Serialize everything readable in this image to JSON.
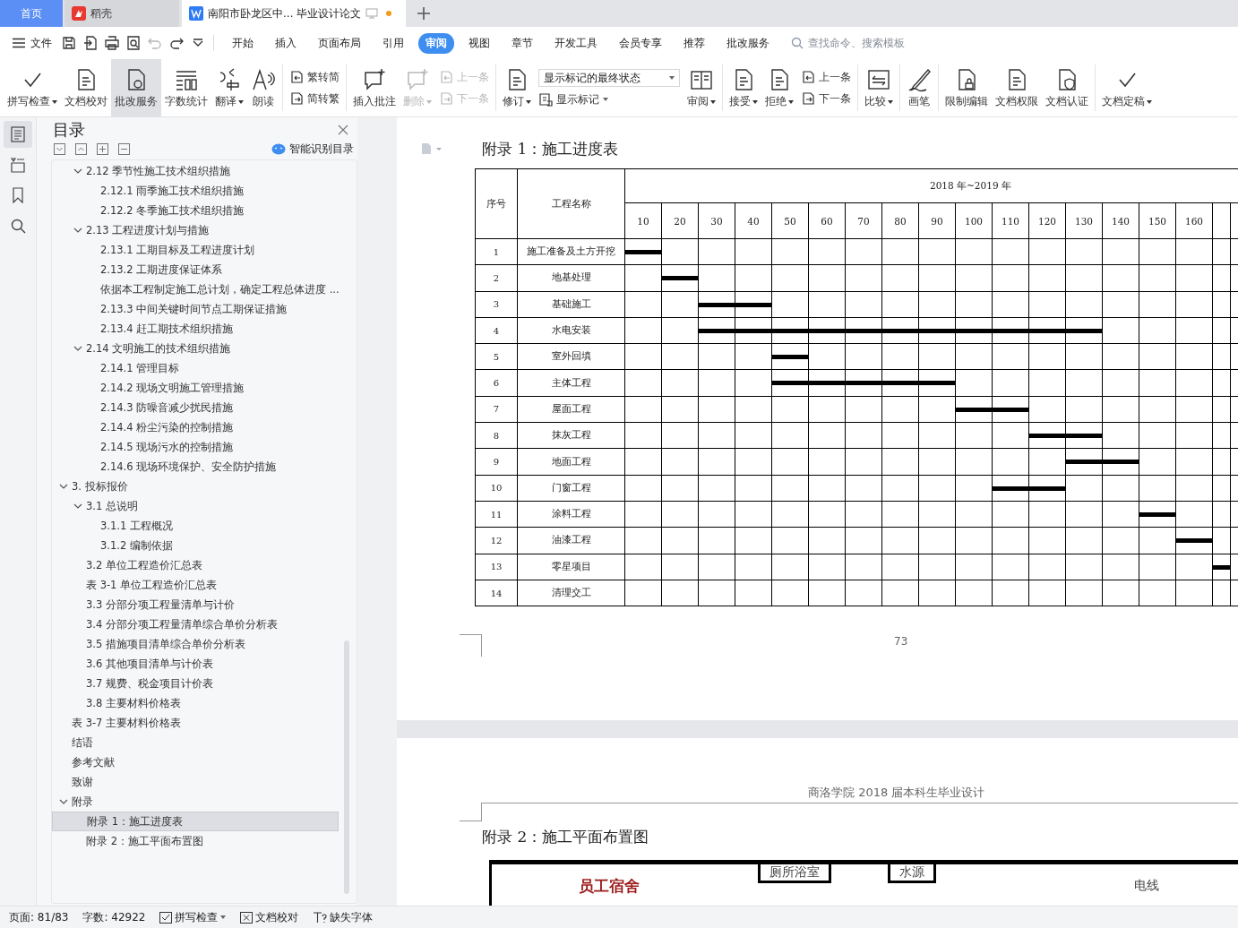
{
  "tabs": [
    {
      "label": "首页",
      "kind": "home",
      "selected": false
    },
    {
      "label": "稻壳",
      "kind": "docer",
      "selected": false
    },
    {
      "label": "南阳市卧龙区中... 毕业设计论文",
      "kind": "doc",
      "selected": true,
      "unsaved": true
    }
  ],
  "quick_access": [
    {
      "kind": "save",
      "disabled": false
    },
    {
      "kind": "export",
      "disabled": false
    },
    {
      "kind": "print",
      "disabled": false
    },
    {
      "kind": "preview",
      "disabled": false
    },
    {
      "kind": "undo",
      "disabled": true
    },
    {
      "kind": "redo",
      "disabled": false
    },
    {
      "kind": "more",
      "disabled": false
    }
  ],
  "file_menu": "文件",
  "menu_tabs": [
    {
      "label": "开始",
      "selected": false
    },
    {
      "label": "插入",
      "selected": false
    },
    {
      "label": "页面布局",
      "selected": false
    },
    {
      "label": "引用",
      "selected": false
    },
    {
      "label": "审阅",
      "selected": true
    },
    {
      "label": "视图",
      "selected": false
    },
    {
      "label": "章节",
      "selected": false
    },
    {
      "label": "开发工具",
      "selected": false
    },
    {
      "label": "会员专享",
      "selected": false
    },
    {
      "label": "推荐",
      "selected": false
    },
    {
      "label": "批改服务",
      "selected": false
    }
  ],
  "command_search": {
    "placeholder": "查找命令、搜索模板"
  },
  "ribbon": [
    [
      {
        "kind": "big",
        "label": "拼写检查",
        "dropdown": true,
        "selected": false,
        "disabled": false
      },
      {
        "kind": "big",
        "label": "文档校对",
        "dropdown": false,
        "selected": false,
        "disabled": false
      },
      {
        "kind": "big",
        "label": "批改服务",
        "dropdown": false,
        "selected": true,
        "disabled": false
      },
      {
        "kind": "big",
        "label": "字数统计",
        "dropdown": false,
        "selected": false,
        "disabled": false
      },
      {
        "kind": "big",
        "label": "翻译",
        "dropdown": true,
        "selected": false,
        "disabled": false
      },
      {
        "kind": "big",
        "label": "朗读",
        "dropdown": false,
        "selected": false,
        "disabled": false
      }
    ],
    [
      {
        "kind": "pair",
        "items": [
          {
            "label": "繁转简",
            "disabled": false
          },
          {
            "label": "简转繁",
            "disabled": false
          }
        ]
      }
    ],
    [
      {
        "kind": "big",
        "label": "插入批注",
        "dropdown": false,
        "selected": false,
        "disabled": false
      },
      {
        "kind": "big",
        "label": "删除",
        "dropdown": true,
        "selected": false,
        "disabled": true
      },
      {
        "kind": "pair",
        "items": [
          {
            "label": "上一条",
            "disabled": true
          },
          {
            "label": "下一条",
            "disabled": true
          }
        ]
      }
    ],
    [
      {
        "kind": "big",
        "label": "修订",
        "dropdown": true,
        "selected": false,
        "disabled": false
      },
      {
        "kind": "select",
        "value": "显示标记的最终状态",
        "below": "显示标记"
      },
      {
        "kind": "big",
        "label": "审阅",
        "dropdown": true,
        "selected": false,
        "disabled": false
      }
    ],
    [
      {
        "kind": "big",
        "label": "接受",
        "dropdown": true,
        "selected": false,
        "disabled": false
      },
      {
        "kind": "big",
        "label": "拒绝",
        "dropdown": true,
        "selected": false,
        "disabled": false
      },
      {
        "kind": "pair",
        "items": [
          {
            "label": "上一条",
            "disabled": false
          },
          {
            "label": "下一条",
            "disabled": false
          }
        ]
      }
    ],
    [
      {
        "kind": "big",
        "label": "比较",
        "dropdown": true,
        "selected": false,
        "disabled": false
      }
    ],
    [
      {
        "kind": "big",
        "label": "画笔",
        "dropdown": false,
        "selected": false,
        "disabled": false
      }
    ],
    [
      {
        "kind": "big",
        "label": "限制编辑",
        "dropdown": false,
        "selected": false,
        "disabled": false
      },
      {
        "kind": "big",
        "label": "文档权限",
        "dropdown": false,
        "selected": false,
        "disabled": false
      },
      {
        "kind": "big",
        "label": "文档认证",
        "dropdown": false,
        "selected": false,
        "disabled": false
      }
    ],
    [
      {
        "kind": "big",
        "label": "文档定稿",
        "dropdown": true,
        "selected": false,
        "disabled": false
      }
    ]
  ],
  "side_rail": [
    {
      "kind": "toc",
      "selected": true
    },
    {
      "kind": "outline",
      "selected": false
    },
    {
      "kind": "bookmark",
      "selected": false
    },
    {
      "kind": "search",
      "selected": false
    }
  ],
  "toc": {
    "title": "目录",
    "smart_button": "智能识别目录",
    "continued_items": [
      {
        "label": "2.12  季节性施工技术组织措施",
        "expanded": true,
        "selected": false,
        "children": [
          {
            "label": "2.12.1  雨季施工技术组织措施",
            "selected": false
          },
          {
            "label": "2.12.2  冬季施工技术组织措施",
            "selected": false
          }
        ]
      },
      {
        "label": "2.13  工程进度计划与措施",
        "expanded": true,
        "selected": false,
        "children": [
          {
            "label": "2.13.1  工期目标及工程进度计划",
            "selected": false
          },
          {
            "label": "2.13.2  工期进度保证体系",
            "selected": false
          },
          {
            "label": "依据本工程制定施工总计划，确定工程总体进度 ...",
            "selected": false
          },
          {
            "label": "2.13.3  中间关键时间节点工期保证措施",
            "selected": false
          },
          {
            "label": "2.13.4  赶工期技术组织措施",
            "selected": false
          }
        ]
      },
      {
        "label": "2.14  文明施工的技术组织措施",
        "expanded": true,
        "selected": false,
        "children": [
          {
            "label": "2.14.1  管理目标",
            "selected": false
          },
          {
            "label": "2.14.2  现场文明施工管理措施",
            "selected": false
          },
          {
            "label": "2.14.3  防噪音减少扰民措施",
            "selected": false
          },
          {
            "label": "2.14.4  粉尘污染的控制措施",
            "selected": false
          },
          {
            "label": "2.14.5  现场污水的控制措施",
            "selected": false
          },
          {
            "label": "2.14.6  现场环境保护、安全防护措施",
            "selected": false
          }
        ]
      }
    ],
    "items": [
      {
        "label": "3.  投标报价",
        "expanded": true,
        "selected": false,
        "children": [
          {
            "label": "3.1  总说明",
            "expanded": true,
            "selected": false,
            "children": [
              {
                "label": "3.1.1  工程概况",
                "selected": false
              },
              {
                "label": "3.1.2  编制依据",
                "selected": false
              }
            ]
          },
          {
            "label": "3.2  单位工程造价汇总表",
            "selected": false
          },
          {
            "label": "表  3-1  单位工程造价汇总表",
            "selected": false
          },
          {
            "label": "3.3  分部分项工程量清单与计价",
            "selected": false
          },
          {
            "label": "3.4  分部分项工程量清单综合单价分析表",
            "selected": false
          },
          {
            "label": "3.5  措施项目清单综合单价分析表",
            "selected": false
          },
          {
            "label": "3.6  其他项目清单与计价表",
            "selected": false
          },
          {
            "label": "3.7  规费、税金项目计价表",
            "selected": false
          },
          {
            "label": "3.8  主要材料价格表",
            "selected": false
          }
        ]
      },
      {
        "label": "表 3-7  主要材料价格表",
        "selected": false
      },
      {
        "label": "结语",
        "selected": false
      },
      {
        "label": "参考文献",
        "selected": false
      },
      {
        "label": "致谢",
        "selected": false
      },
      {
        "label": "附录",
        "expanded": true,
        "selected": false,
        "children": [
          {
            "label": "附录 1：施工进度表",
            "selected": true
          },
          {
            "label": "附录 2：施工平面布置图",
            "selected": false
          }
        ]
      }
    ]
  },
  "page1": {
    "heading": "附录 1：施工进度表",
    "schedule": {
      "col_no": "序号",
      "col_name": "工程名称",
      "period": "2018 年~2019 年",
      "days": [
        "10",
        "20",
        "30",
        "40",
        "50",
        "60",
        "70",
        "80",
        "90",
        "100",
        "110",
        "120",
        "130",
        "140",
        "150",
        "160"
      ],
      "rows": [
        {
          "no": "1",
          "name": "施工准备及土方开挖",
          "filled": [
            true,
            false,
            false,
            false,
            false,
            false,
            false,
            false,
            false,
            false,
            false,
            false,
            false,
            false,
            false,
            false,
            false
          ]
        },
        {
          "no": "2",
          "name": "地基处理",
          "filled": [
            false,
            true,
            false,
            false,
            false,
            false,
            false,
            false,
            false,
            false,
            false,
            false,
            false,
            false,
            false,
            false,
            false
          ]
        },
        {
          "no": "3",
          "name": "基础施工",
          "filled": [
            false,
            false,
            true,
            true,
            false,
            false,
            false,
            false,
            false,
            false,
            false,
            false,
            false,
            false,
            false,
            false,
            false
          ]
        },
        {
          "no": "4",
          "name": "水电安装",
          "filled": [
            false,
            false,
            true,
            true,
            true,
            true,
            true,
            true,
            true,
            true,
            true,
            true,
            true,
            false,
            false,
            false,
            false
          ]
        },
        {
          "no": "5",
          "name": "室外回填",
          "filled": [
            false,
            false,
            false,
            false,
            true,
            false,
            false,
            false,
            false,
            false,
            false,
            false,
            false,
            false,
            false,
            false,
            false
          ]
        },
        {
          "no": "6",
          "name": "主体工程",
          "filled": [
            false,
            false,
            false,
            false,
            true,
            true,
            true,
            true,
            true,
            false,
            false,
            false,
            false,
            false,
            false,
            false,
            false
          ]
        },
        {
          "no": "7",
          "name": "屋面工程",
          "filled": [
            false,
            false,
            false,
            false,
            false,
            false,
            false,
            false,
            false,
            true,
            true,
            false,
            false,
            false,
            false,
            false,
            false
          ]
        },
        {
          "no": "8",
          "name": "抹灰工程",
          "filled": [
            false,
            false,
            false,
            false,
            false,
            false,
            false,
            false,
            false,
            false,
            false,
            true,
            true,
            false,
            false,
            false,
            false
          ]
        },
        {
          "no": "9",
          "name": "地面工程",
          "filled": [
            false,
            false,
            false,
            false,
            false,
            false,
            false,
            false,
            false,
            false,
            false,
            false,
            true,
            true,
            false,
            false,
            false
          ]
        },
        {
          "no": "10",
          "name": "门窗工程",
          "filled": [
            false,
            false,
            false,
            false,
            false,
            false,
            false,
            false,
            false,
            false,
            true,
            true,
            false,
            false,
            false,
            false,
            false
          ]
        },
        {
          "no": "11",
          "name": "涂料工程",
          "filled": [
            false,
            false,
            false,
            false,
            false,
            false,
            false,
            false,
            false,
            false,
            false,
            false,
            false,
            false,
            true,
            false,
            false
          ]
        },
        {
          "no": "12",
          "name": "油漆工程",
          "filled": [
            false,
            false,
            false,
            false,
            false,
            false,
            false,
            false,
            false,
            false,
            false,
            false,
            false,
            false,
            false,
            true,
            false
          ]
        },
        {
          "no": "13",
          "name": "零星项目",
          "filled": [
            false,
            false,
            false,
            false,
            false,
            false,
            false,
            false,
            false,
            false,
            false,
            false,
            false,
            false,
            false,
            false,
            true
          ]
        },
        {
          "no": "14",
          "name": "清理交工",
          "filled": [
            false,
            false,
            false,
            false,
            false,
            false,
            false,
            false,
            false,
            false,
            false,
            false,
            false,
            false,
            false,
            false,
            false
          ]
        }
      ]
    },
    "page_number": "73"
  },
  "page2": {
    "header": "商洛学院 2018 届本科生毕业设计",
    "heading": "附录 2：施工平面布置图",
    "plan_labels": [
      "员工宿舍",
      "厕所浴室",
      "水源",
      "电线"
    ]
  },
  "status_bar": {
    "page": "页面: 81/83",
    "words": "字数: 42922",
    "spell_check": "拼写检查",
    "proofread": "文档校对",
    "missing_fonts": "缺失字体"
  }
}
